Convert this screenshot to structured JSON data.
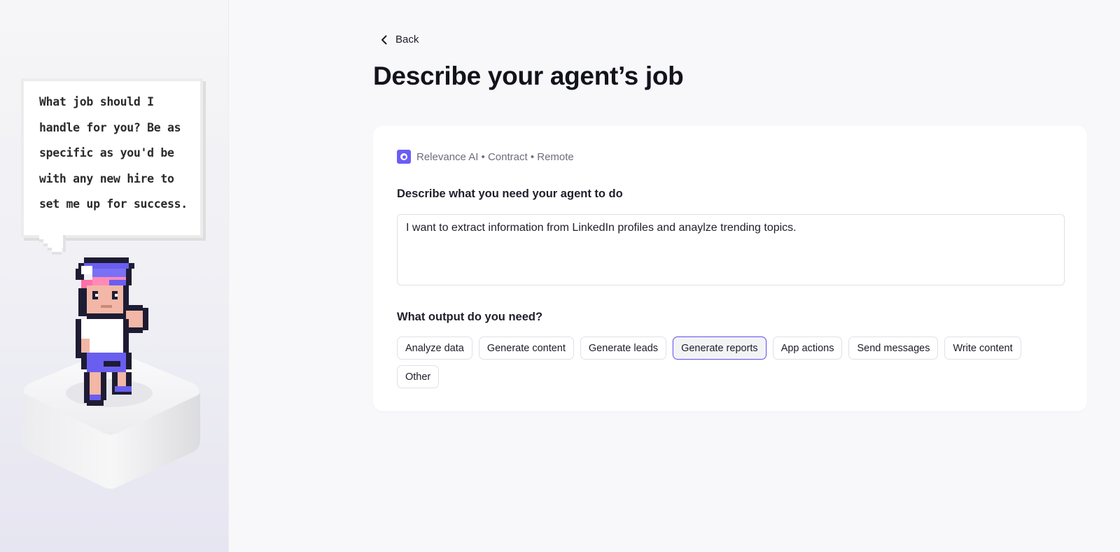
{
  "assistant": {
    "speech": "What job should I handle for you? Be as specific as you'd be with any new hire to set me up for success."
  },
  "nav": {
    "back_label": "Back"
  },
  "page": {
    "title": "Describe your agent’s job"
  },
  "job_meta": {
    "text": "Relevance AI • Contract • Remote",
    "logo_icon": "relevance-ai-logo-icon"
  },
  "description": {
    "label": "Describe what you need your agent to do",
    "value": "I want to extract information from LinkedIn profiles and anaylze trending topics."
  },
  "output": {
    "label": "What output do you need?",
    "options": [
      {
        "label": "Analyze data",
        "selected": false
      },
      {
        "label": "Generate content",
        "selected": false
      },
      {
        "label": "Generate leads",
        "selected": false
      },
      {
        "label": "Generate reports",
        "selected": true
      },
      {
        "label": "App actions",
        "selected": false
      },
      {
        "label": "Send messages",
        "selected": false
      },
      {
        "label": "Write content",
        "selected": false
      },
      {
        "label": "Other",
        "selected": false
      }
    ]
  },
  "colors": {
    "accent": "#6b5cf6",
    "title": "#12131c",
    "muted": "#6c6e7c"
  }
}
